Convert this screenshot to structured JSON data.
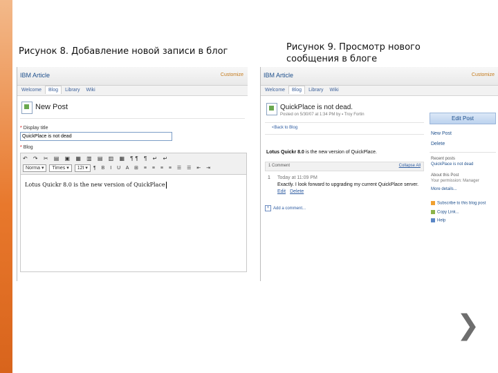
{
  "captions": {
    "left": "Рисунок 8. Добавление новой записи в блог",
    "right": "Рисунок 9. Просмотр нового сообщения в блоге"
  },
  "left_shot": {
    "app_title": "IBM Article",
    "customize": "Customize",
    "tabs": [
      "Welcome",
      "Blog",
      "Library",
      "Wiki"
    ],
    "active_tab": "Blog",
    "heading": "New Post",
    "display_title_label": "Display title",
    "display_title_value": "QuickPlace is not dead",
    "blog_label": "Blog",
    "toolbar_row1": "↶ ↷  ✂ ▤ ▣  ▦ ▥ ▤ ▥ ▦  ¶¶ ¶  ↵ ↵",
    "style_select": "Norma",
    "font_select": "Times",
    "size_select": "12t",
    "toolbar_row2_icons": "¶  B I U  A ⊞  ≡ ≡ ≡ ≡  ☰ ☰ ⇤ ⇥",
    "editor_text": "Lotus Quickr 8.0 is the new version of QuickPlace"
  },
  "right_shot": {
    "app_title": "IBM Article",
    "customize": "Customize",
    "tabs": [
      "Welcome",
      "Blog",
      "Library",
      "Wiki"
    ],
    "active_tab": "Blog",
    "post_title": "QuickPlace is not dead.",
    "post_meta": "Posted on 5/30/07 at 1:34 PM by ▪ Troy Fortin",
    "back_link": "<Back to Blog",
    "body_bold": "Lotus Quickr 8.0",
    "body_rest": " is the new version of QuickPlace.",
    "comments_count": "1 Comment",
    "collapse_all": "Collapse All",
    "comment_number": "1",
    "comment_time": "Today at 11:09 PM",
    "comment_text": "Exactly. I look forward to upgrading my current QuickPlace server.",
    "comment_edit": "Edit",
    "comment_delete": "Delete",
    "add_comment": "Add a comment...",
    "edit_post_button": "Edit Post",
    "side_new_post": "New Post",
    "side_delete": "Delete",
    "recent_posts_label": "Recent posts",
    "recent_post_item": "QuickPlace is not dead",
    "about_label": "About this Post",
    "permission_text": "Your permission: Manager",
    "more_details": "More details...",
    "subscribe": "Subscribe to this blog post",
    "copy_link": "Copy Link...",
    "help": "Help"
  }
}
